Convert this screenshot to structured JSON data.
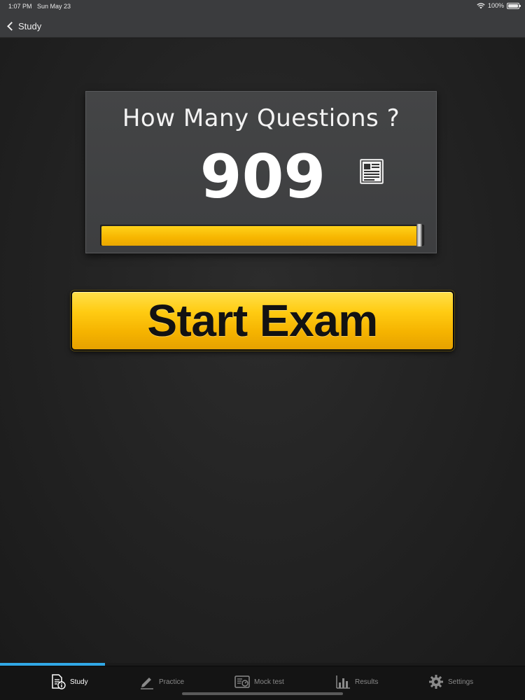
{
  "status_bar": {
    "time": "1:07 PM",
    "date": "Sun May 23",
    "battery": "100%",
    "battery_level": 1.0
  },
  "nav": {
    "back_label": "Study"
  },
  "exam_panel": {
    "title": "How Many Questions ?",
    "question_count": "909",
    "slider_level": 1.0
  },
  "start_button": {
    "label": "Start Exam"
  },
  "tab_strip_progress": 0.2,
  "tabs": [
    {
      "label": "Study",
      "icon": "study-document-icon",
      "active": true
    },
    {
      "label": "Practice",
      "icon": "pencil-icon",
      "active": false
    },
    {
      "label": "Mock test",
      "icon": "mock-test-icon",
      "active": false
    },
    {
      "label": "Results",
      "icon": "bar-chart-icon",
      "active": false
    },
    {
      "label": "Settings",
      "icon": "gear-icon",
      "active": false
    }
  ],
  "colors": {
    "accent_yellow": "#ffcb12",
    "tab_indicator_blue": "#31a8e6",
    "background": "#1e1e1e"
  }
}
